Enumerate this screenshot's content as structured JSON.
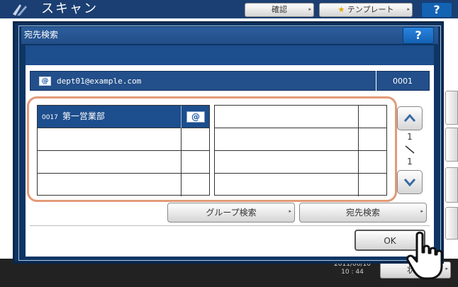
{
  "background": {
    "title": "スキャン",
    "confirm_label": "確認",
    "template_label": "テンプレート",
    "help_label": "?",
    "datetime_line1": "2011/06/10",
    "datetime_line2": "10 : 44",
    "status_label": "状況"
  },
  "dialog": {
    "title": "宛先検索",
    "help_label": "?",
    "selected_address": {
      "email": "dept01@example.com",
      "number": "0001"
    },
    "left_list": [
      {
        "number": "0017",
        "name": "第一営業部",
        "icon": "email-at-icon",
        "selected": true
      },
      {
        "number": "",
        "name": "",
        "icon": "",
        "selected": false
      },
      {
        "number": "",
        "name": "",
        "icon": "",
        "selected": false
      },
      {
        "number": "",
        "name": "",
        "icon": "",
        "selected": false
      }
    ],
    "right_list": [
      {
        "name": ""
      },
      {
        "name": ""
      },
      {
        "name": ""
      },
      {
        "name": ""
      }
    ],
    "page": {
      "current": "1",
      "total": "1"
    },
    "group_search_label": "グループ検索",
    "address_search_label": "宛先検索",
    "ok_label": "OK",
    "at_symbol": "@",
    "corner_mark": "▸"
  },
  "colors": {
    "header_blue": "#1b3f73",
    "selection_blue": "#1d4e8d",
    "highlight_orange": "#e39a78"
  }
}
